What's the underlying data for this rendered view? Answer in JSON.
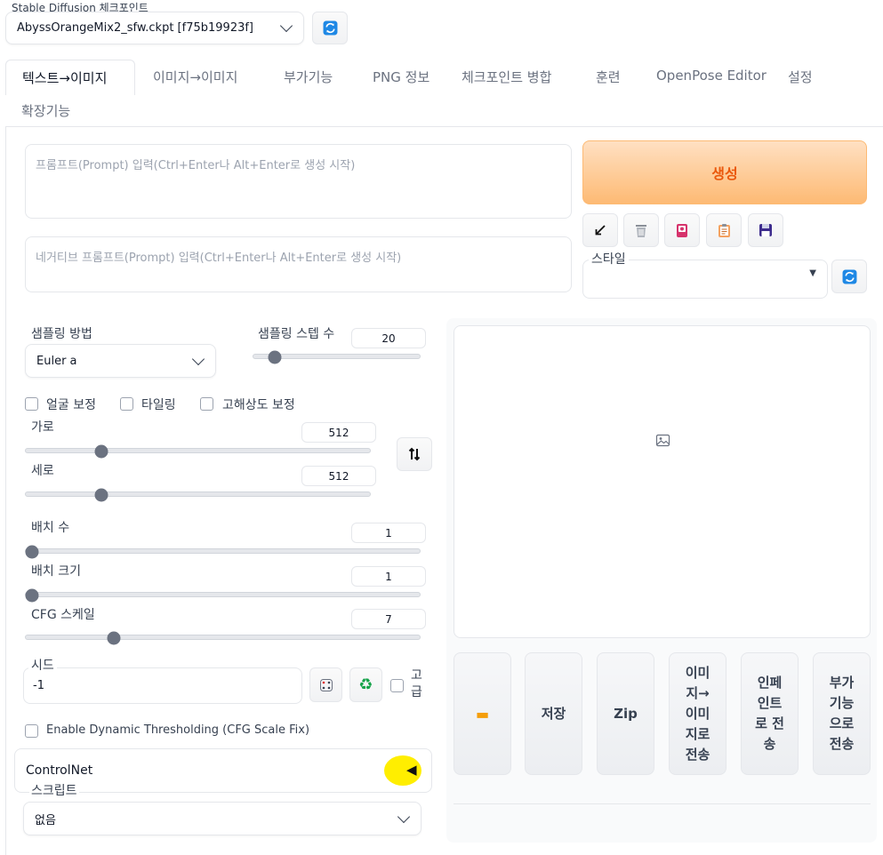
{
  "checkpoint": {
    "label": "Stable Diffusion 체크포인트",
    "value": "AbyssOrangeMix2_sfw.ckpt [f75b19923f]"
  },
  "tabs": [
    "텍스트→이미지",
    "이미지→이미지",
    "부가기능",
    "PNG 정보",
    "체크포인트 병합",
    "훈련",
    "OpenPose Editor",
    "설정",
    "확장기능"
  ],
  "prompt": {
    "placeholder": "프롬프트(Prompt) 입력(Ctrl+Enter나 Alt+Enter로 생성 시작)"
  },
  "negative_prompt": {
    "placeholder": "네거티브 프롬프트(Prompt) 입력(Ctrl+Enter나 Alt+Enter로 생성 시작)"
  },
  "generate": {
    "label": "생성"
  },
  "style": {
    "label": "스타일",
    "value": ""
  },
  "sampling": {
    "method_label": "샘플링 방법",
    "method_value": "Euler a",
    "steps_label": "샘플링 스텝 수",
    "steps_value": "20",
    "steps_fraction": 0.13
  },
  "checks": {
    "face": "얼굴 보정",
    "tiling": "타일링",
    "hires": "고해상도 보정"
  },
  "width": {
    "label": "가로",
    "value": "512",
    "fraction": 0.22
  },
  "height": {
    "label": "세로",
    "value": "512",
    "fraction": 0.22
  },
  "batch_count": {
    "label": "배치 수",
    "value": "1",
    "fraction": 0.0
  },
  "batch_size": {
    "label": "배치 크기",
    "value": "1",
    "fraction": 0.0
  },
  "cfg": {
    "label": "CFG 스케일",
    "value": "7",
    "fraction": 0.21
  },
  "seed": {
    "label": "시드",
    "value": "-1",
    "advanced_label": "고급"
  },
  "dynamic_thresholding": {
    "label": "Enable Dynamic Thresholding (CFG Scale Fix)"
  },
  "controlnet": {
    "label": "ControlNet"
  },
  "script": {
    "label": "스크립트",
    "value": "없음"
  },
  "output_buttons": {
    "save": "저장",
    "zip": "Zip",
    "to_img2img": "이미지→이미지로 전송",
    "to_inpaint": "인페인트로 전송",
    "to_extras": "부가기능으로 전송"
  },
  "colors": {
    "accent": "#ea580c",
    "generate_bg": "#fdba74",
    "highlight": "#ffee00"
  }
}
